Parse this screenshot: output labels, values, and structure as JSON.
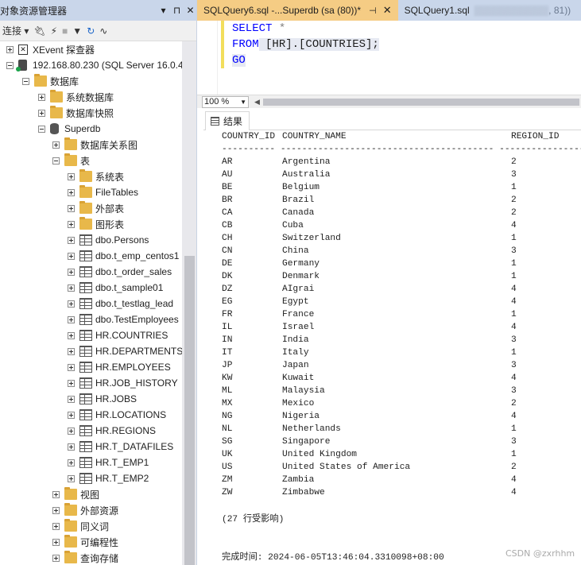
{
  "object_explorer": {
    "title": "对象资源管理器",
    "title_buttons": [
      "▾",
      "⊓",
      "✕"
    ],
    "toolbar": {
      "connect_label": "连接"
    },
    "tree": [
      {
        "level": 0,
        "expander": "plus",
        "icon": "xevent-icon",
        "label": "XEvent 探查器"
      },
      {
        "level": 0,
        "expander": "minus",
        "icon": "server-icon",
        "label": "192.168.80.230 (SQL Server 16.0.4"
      },
      {
        "level": 1,
        "expander": "minus",
        "icon": "folder-icon",
        "label": "数据库"
      },
      {
        "level": 2,
        "expander": "plus",
        "icon": "folder-icon",
        "label": "系统数据库"
      },
      {
        "level": 2,
        "expander": "plus",
        "icon": "folder-icon",
        "label": "数据库快照"
      },
      {
        "level": 2,
        "expander": "minus",
        "icon": "database-icon",
        "label": "Superdb"
      },
      {
        "level": 3,
        "expander": "plus",
        "icon": "folder-icon",
        "label": "数据库关系图"
      },
      {
        "level": 3,
        "expander": "minus",
        "icon": "folder-icon",
        "label": "表"
      },
      {
        "level": 4,
        "expander": "plus",
        "icon": "folder-icon",
        "label": "系统表"
      },
      {
        "level": 4,
        "expander": "plus",
        "icon": "folder-icon",
        "label": "FileTables"
      },
      {
        "level": 4,
        "expander": "plus",
        "icon": "folder-icon",
        "label": "外部表"
      },
      {
        "level": 4,
        "expander": "plus",
        "icon": "folder-icon",
        "label": "图形表"
      },
      {
        "level": 4,
        "expander": "plus",
        "icon": "table-icon",
        "label": "dbo.Persons"
      },
      {
        "level": 4,
        "expander": "plus",
        "icon": "table-icon",
        "label": "dbo.t_emp_centos1"
      },
      {
        "level": 4,
        "expander": "plus",
        "icon": "table-icon",
        "label": "dbo.t_order_sales"
      },
      {
        "level": 4,
        "expander": "plus",
        "icon": "table-icon",
        "label": "dbo.t_sample01"
      },
      {
        "level": 4,
        "expander": "plus",
        "icon": "table-icon",
        "label": "dbo.t_testlag_lead"
      },
      {
        "level": 4,
        "expander": "plus",
        "icon": "table-icon",
        "label": "dbo.TestEmployees"
      },
      {
        "level": 4,
        "expander": "plus",
        "icon": "table-icon",
        "label": "HR.COUNTRIES"
      },
      {
        "level": 4,
        "expander": "plus",
        "icon": "table-icon",
        "label": "HR.DEPARTMENTS"
      },
      {
        "level": 4,
        "expander": "plus",
        "icon": "table-icon",
        "label": "HR.EMPLOYEES"
      },
      {
        "level": 4,
        "expander": "plus",
        "icon": "table-icon",
        "label": "HR.JOB_HISTORY"
      },
      {
        "level": 4,
        "expander": "plus",
        "icon": "table-icon",
        "label": "HR.JOBS"
      },
      {
        "level": 4,
        "expander": "plus",
        "icon": "table-icon",
        "label": "HR.LOCATIONS"
      },
      {
        "level": 4,
        "expander": "plus",
        "icon": "table-icon",
        "label": "HR.REGIONS"
      },
      {
        "level": 4,
        "expander": "plus",
        "icon": "table-icon",
        "label": "HR.T_DATAFILES"
      },
      {
        "level": 4,
        "expander": "plus",
        "icon": "table-icon",
        "label": "HR.T_EMP1"
      },
      {
        "level": 4,
        "expander": "plus",
        "icon": "table-icon",
        "label": "HR.T_EMP2"
      },
      {
        "level": 3,
        "expander": "plus",
        "icon": "folder-icon",
        "label": "视图"
      },
      {
        "level": 3,
        "expander": "plus",
        "icon": "folder-icon",
        "label": "外部资源"
      },
      {
        "level": 3,
        "expander": "plus",
        "icon": "folder-icon",
        "label": "同义词"
      },
      {
        "level": 3,
        "expander": "plus",
        "icon": "folder-icon",
        "label": "可编程性"
      },
      {
        "level": 3,
        "expander": "plus",
        "icon": "folder-icon",
        "label": "查询存储"
      }
    ]
  },
  "tabs": [
    {
      "label": "SQLQuery6.sql -...Superdb (sa (80))*",
      "pin": "⊣",
      "close": "✕",
      "active": true
    },
    {
      "label": "SQLQuery1.sql",
      "suffix": ", 81))",
      "active": false
    }
  ],
  "editor": {
    "line1_kw": "SELECT",
    "line1_rest": " *",
    "line2_kw": "FROM",
    "line2_rest": " [HR].[COUNTRIES];",
    "line3_kw": "GO"
  },
  "zoom": {
    "value": "100 %"
  },
  "results_tab": {
    "label": "结果"
  },
  "results": {
    "columns": [
      "COUNTRY_ID",
      "COUNTRY_NAME",
      "REGION_ID"
    ],
    "dashes": "---------- ---------------------------------------- ------------------",
    "rows": [
      [
        "AR",
        "Argentina",
        "2"
      ],
      [
        "AU",
        "Australia",
        "3"
      ],
      [
        "BE",
        "Belgium",
        "1"
      ],
      [
        "BR",
        "Brazil",
        "2"
      ],
      [
        "CA",
        "Canada",
        "2"
      ],
      [
        "CB",
        "Cuba",
        "4"
      ],
      [
        "CH",
        "Switzerland",
        "1"
      ],
      [
        "CN",
        "China",
        "3"
      ],
      [
        "DE",
        "Germany",
        "1"
      ],
      [
        "DK",
        "Denmark",
        "1"
      ],
      [
        "DZ",
        "AIgrai",
        "4"
      ],
      [
        "EG",
        "Egypt",
        "4"
      ],
      [
        "FR",
        "France",
        "1"
      ],
      [
        "IL",
        "Israel",
        "4"
      ],
      [
        "IN",
        "India",
        "3"
      ],
      [
        "IT",
        "Italy",
        "1"
      ],
      [
        "JP",
        "Japan",
        "3"
      ],
      [
        "KW",
        "Kuwait",
        "4"
      ],
      [
        "ML",
        "Malaysia",
        "3"
      ],
      [
        "MX",
        "Mexico",
        "2"
      ],
      [
        "NG",
        "Nigeria",
        "4"
      ],
      [
        "NL",
        "Netherlands",
        "1"
      ],
      [
        "SG",
        "Singapore",
        "3"
      ],
      [
        "UK",
        "United Kingdom",
        "1"
      ],
      [
        "US",
        "United States of America",
        "2"
      ],
      [
        "ZM",
        "Zambia",
        "4"
      ],
      [
        "ZW",
        "Zimbabwe",
        "4"
      ]
    ],
    "rows_affected": "(27 行受影响)",
    "completion": "完成时间: 2024-06-05T13:46:04.3310098+08:00"
  },
  "watermark": "CSDN @zxrhhm"
}
